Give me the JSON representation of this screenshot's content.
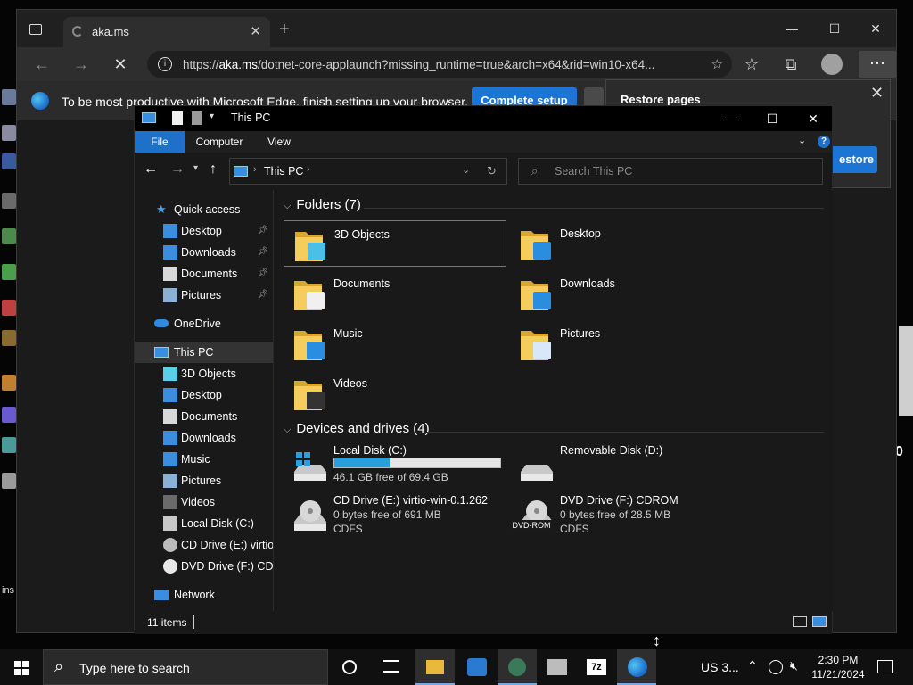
{
  "desktop": {
    "icon_colors": [
      "#6a7a9a",
      "#8a8aa0",
      "#3a5aa0",
      "#6a6a6a",
      "#4a8a4a",
      "#4aa04a",
      "#c04040",
      "#8a6a30",
      "#c08030",
      "#6a5ad0",
      "#4a9a9a",
      "#9a9a9a"
    ],
    "edge_side_text": "ins",
    "right_mark": "0"
  },
  "edge": {
    "tab_title": "aka.ms",
    "new_tab": "+",
    "address_prefix": "https://",
    "address_domain": "aka.ms",
    "address_rest": "/dotnet-core-applaunch?missing_runtime=true&arch=x64&rid=win10-x64...",
    "infobar_text": "To be most productive with Microsoft Edge, finish setting up your browser.",
    "complete_setup_label": "Complete setup",
    "restore_title": "Restore pages",
    "restore_button": "estore"
  },
  "explorer": {
    "title": "This PC",
    "ribbon_tabs": [
      "File",
      "Computer",
      "View"
    ],
    "address_path": "This PC",
    "search_placeholder": "Search This PC",
    "folders_header": "Folders (7)",
    "folders": [
      {
        "name": "3D Objects",
        "icon": "3d-objects-folder-icon"
      },
      {
        "name": "Desktop",
        "icon": "desktop-folder-icon"
      },
      {
        "name": "Documents",
        "icon": "documents-folder-icon"
      },
      {
        "name": "Downloads",
        "icon": "downloads-folder-icon"
      },
      {
        "name": "Music",
        "icon": "music-folder-icon"
      },
      {
        "name": "Pictures",
        "icon": "pictures-folder-icon"
      },
      {
        "name": "Videos",
        "icon": "videos-folder-icon"
      }
    ],
    "drives_header": "Devices and drives (4)",
    "drives": [
      {
        "name": "Local Disk (C:)",
        "detail": "46.1 GB free of 69.4 GB",
        "used_fraction": 0.336,
        "icon": "windows-disk-icon"
      },
      {
        "name": "Removable Disk (D:)",
        "detail": "",
        "icon": "removable-disk-icon"
      },
      {
        "name": "CD Drive (E:) virtio-win-0.1.262",
        "detail": "0 bytes free of 691 MB",
        "fs": "CDFS",
        "icon": "cd-drive-icon"
      },
      {
        "name": "DVD Drive (F:) CDROM",
        "detail": "0 bytes free of 28.5 MB",
        "fs": "CDFS",
        "icon": "dvd-drive-icon",
        "badge": "DVD-ROM"
      }
    ],
    "sidebar": {
      "quick_access": "Quick access",
      "qa_items": [
        "Desktop",
        "Downloads",
        "Documents",
        "Pictures"
      ],
      "onedrive": "OneDrive",
      "this_pc": "This PC",
      "pc_items": [
        "3D Objects",
        "Desktop",
        "Documents",
        "Downloads",
        "Music",
        "Pictures",
        "Videos",
        "Local Disk (C:)",
        "CD Drive (E:) virtio-w",
        "DVD Drive (F:) CDRO"
      ],
      "network": "Network"
    },
    "status": "11 items"
  },
  "taskbar": {
    "search_placeholder": "Type here to search",
    "language": "US 3...",
    "time": "2:30 PM",
    "date": "11/21/2024"
  }
}
